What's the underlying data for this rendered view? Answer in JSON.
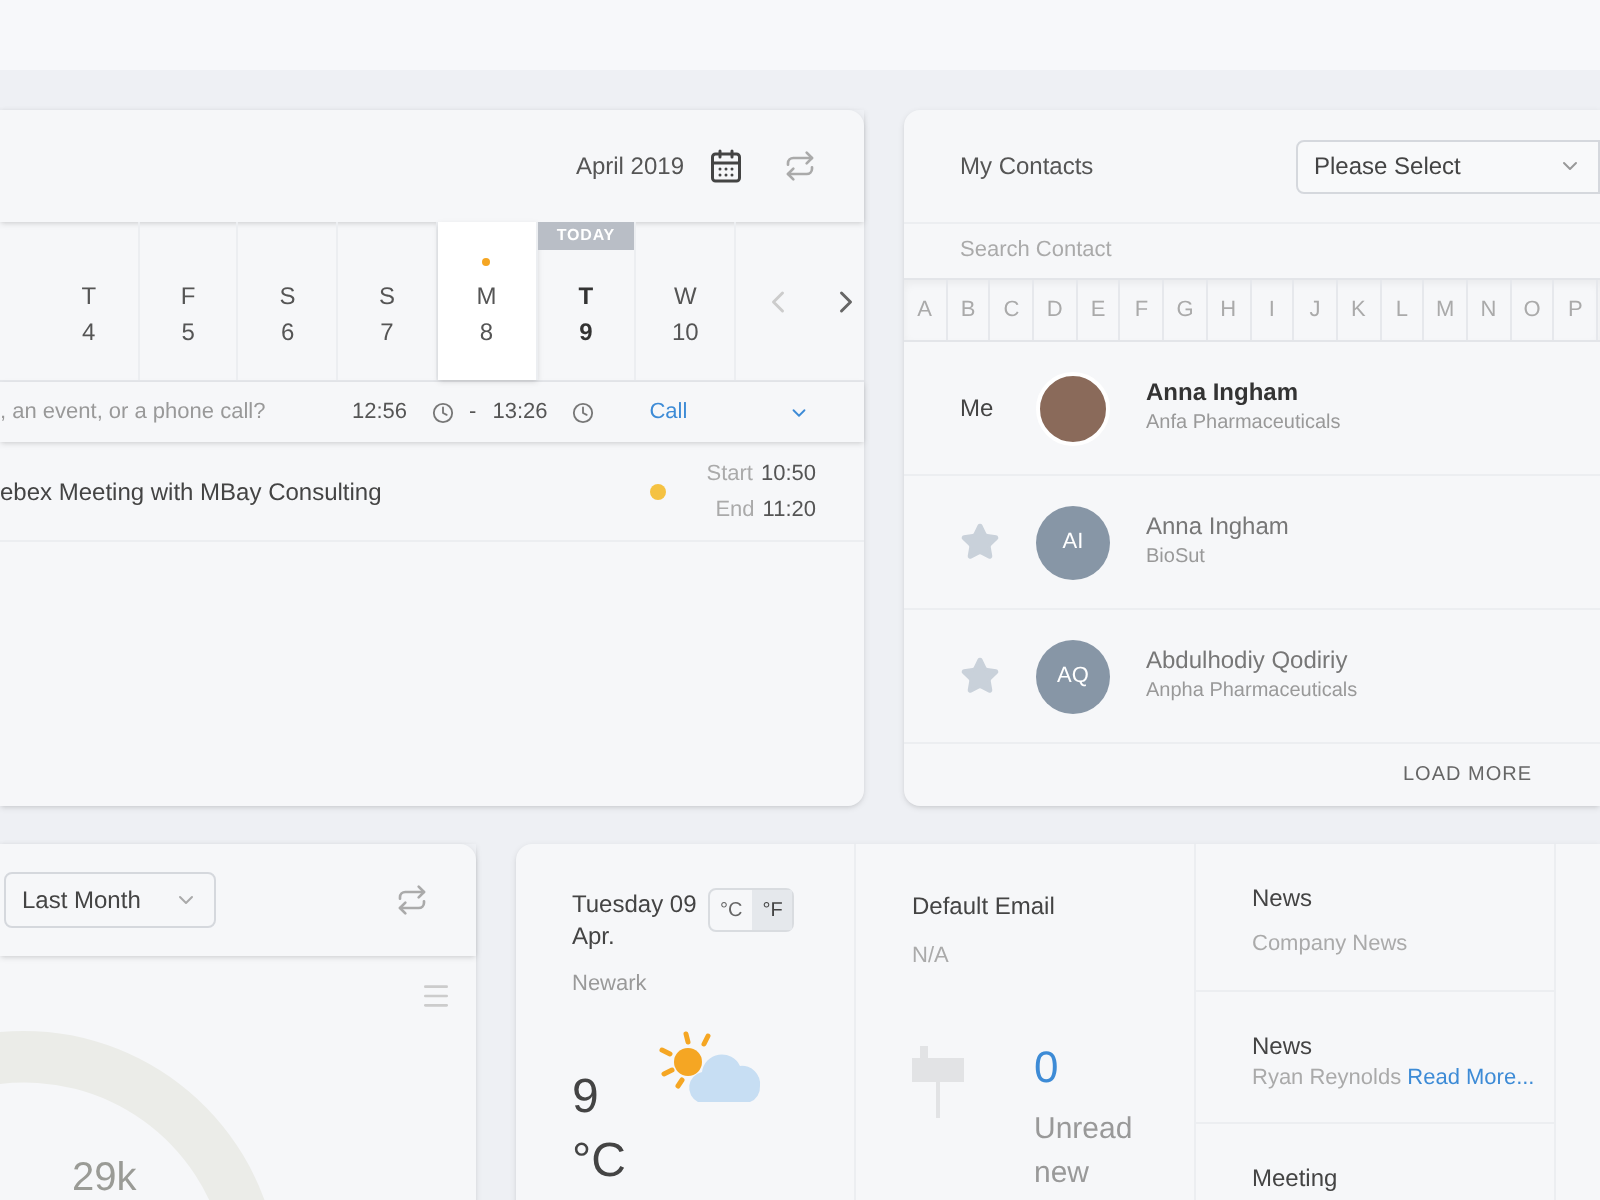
{
  "calendar": {
    "month": "April 2019",
    "today_label": "TODAY",
    "days": [
      {
        "letter": "T",
        "number": "4",
        "selected": false,
        "today": false,
        "has_event": false
      },
      {
        "letter": "F",
        "number": "5",
        "selected": false,
        "today": false,
        "has_event": false
      },
      {
        "letter": "S",
        "number": "6",
        "selected": false,
        "today": false,
        "has_event": false
      },
      {
        "letter": "S",
        "number": "7",
        "selected": false,
        "today": false,
        "has_event": false
      },
      {
        "letter": "M",
        "number": "8",
        "selected": true,
        "today": false,
        "has_event": true
      },
      {
        "letter": "T",
        "number": "9",
        "selected": false,
        "today": true,
        "has_event": false
      },
      {
        "letter": "W",
        "number": "10",
        "selected": false,
        "today": false,
        "has_event": false
      }
    ],
    "new_entry": {
      "placeholder": ", an event, or a phone call?",
      "start": "12:56",
      "separator": "-",
      "end": "13:26",
      "type": "Call"
    },
    "events": [
      {
        "title": "ebex Meeting with MBay Consulting",
        "color": "#f5c242",
        "start_label": "Start",
        "start": "10:50",
        "end_label": "End",
        "end": "11:20"
      }
    ]
  },
  "contacts": {
    "title": "My Contacts",
    "filter": "Please Select",
    "search_placeholder": "Search Contact",
    "letters": [
      "A",
      "B",
      "C",
      "D",
      "E",
      "F",
      "G",
      "H",
      "I",
      "J",
      "K",
      "L",
      "M",
      "N",
      "O",
      "P"
    ],
    "items": [
      {
        "kind": "me",
        "label": "Me",
        "name": "Anna Ingham",
        "company": "Anfa Pharmaceuticals"
      },
      {
        "kind": "contact",
        "starred": false,
        "initials": "AI",
        "name": "Anna Ingham",
        "company": "BioSut"
      },
      {
        "kind": "contact",
        "starred": false,
        "initials": "AQ",
        "name": "Abdulhodiy Qodiriy",
        "company": "Anpha Pharmaceuticals"
      }
    ],
    "load_more": "LOAD MORE"
  },
  "stats": {
    "period": "Last Month",
    "center_value": "29k"
  },
  "weather": {
    "date": "Tuesday 09 Apr.",
    "units": [
      {
        "label": "°C",
        "selected": false
      },
      {
        "label": "°F",
        "selected": true
      }
    ],
    "city": "Newark",
    "temperature": "9",
    "unit": "°C"
  },
  "email": {
    "title": "Default Email",
    "address": "N/A",
    "count": "0",
    "count_label": "Unread new"
  },
  "news": [
    {
      "title": "News",
      "text": "Company News"
    },
    {
      "title": "News",
      "text": "Ryan Reynolds",
      "link": "Read More..."
    },
    {
      "title": "Meeting"
    }
  ]
}
